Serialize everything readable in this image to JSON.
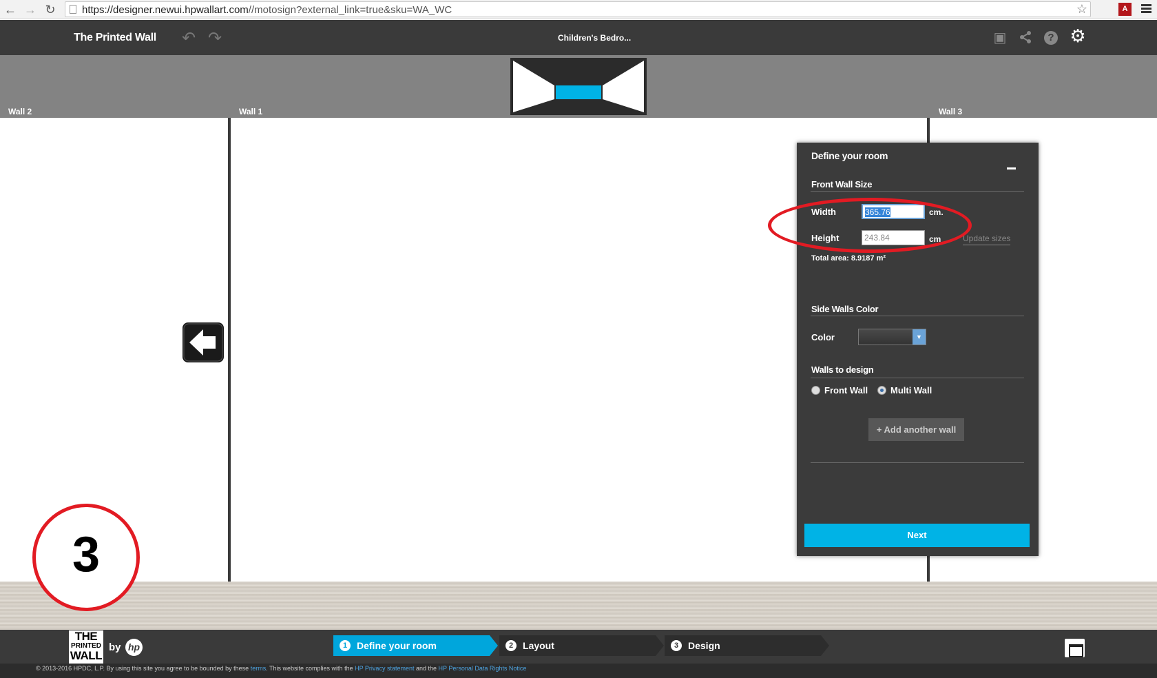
{
  "browser": {
    "url_host": "https://designer.newui.hpwallart.com",
    "url_path": "//motosign?external_link=true&sku=WA_WC",
    "back_icon": "←",
    "forward_icon": "→",
    "reload_icon": "↻",
    "star_icon": "☆",
    "pdf_icon_text": "A"
  },
  "header": {
    "app_title": "The Printed Wall",
    "doc_title": "Children's Bedro...",
    "undo_icon": "↶",
    "redo_icon": "↷",
    "save_icon": "▣",
    "share_icon": "⋖",
    "help_icon": "?",
    "settings_icon": "⚙"
  },
  "walls": {
    "left": "Wall 2",
    "front": "Wall 1",
    "right": "Wall 3",
    "thumb_accent": "#00b3e6"
  },
  "annotation": {
    "step_number": "3",
    "color": "#e21b23"
  },
  "panel": {
    "title": "Define your room",
    "front_wall_section": "Front Wall Size",
    "width_label": "Width",
    "width_value": "365.76",
    "width_unit": "cm.",
    "height_label": "Height",
    "height_value": "243.84",
    "height_unit": "cm",
    "update_sizes": "Update sizes",
    "total_area": "Total area: 8.9187 m²",
    "side_walls_section": "Side Walls Color",
    "color_label": "Color",
    "color_arrow": "▼",
    "walls_to_design_section": "Walls to design",
    "front_wall_option": "Front Wall",
    "multi_wall_option": "Multi Wall",
    "selected_option": "Multi Wall",
    "add_wall_button": "+ Add another wall",
    "next_button": "Next"
  },
  "bottom": {
    "logo_line1": "THE",
    "logo_line2": "PRINTED",
    "logo_line3": "WALL",
    "by_text": "by",
    "hp_text": "hp",
    "steps": [
      {
        "num": "1",
        "label": "Define your room"
      },
      {
        "num": "2",
        "label": "Layout"
      },
      {
        "num": "3",
        "label": "Design"
      }
    ]
  },
  "footer": {
    "copyright": "© 2013-2016 HPDC, L.P.  By using this site you agree to be bounded by these",
    "terms": "terms",
    "compliance": ". This website complies with the",
    "privacy_link": "HP Privacy statement",
    "and_the": "and the",
    "rights_link": "HP Personal Data Rights Notice"
  }
}
